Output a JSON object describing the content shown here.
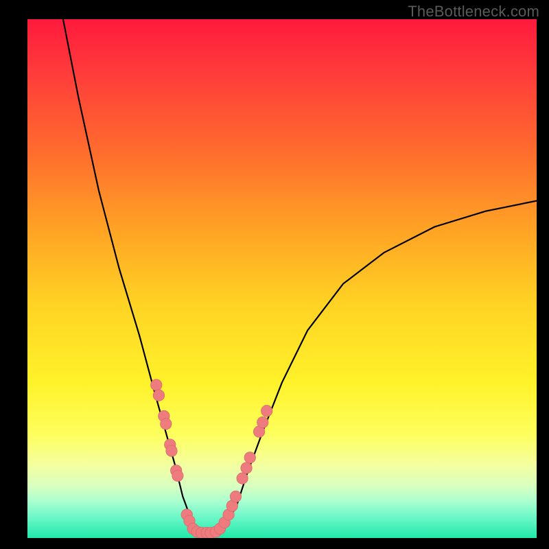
{
  "watermark": "TheBottleneck.com",
  "colors": {
    "curve": "#000000",
    "marker_fill": "#ee7b7d",
    "marker_stroke": "#d86a6c",
    "green_band": "#20e9a8"
  },
  "chart_data": {
    "type": "line",
    "title": "",
    "xlabel": "",
    "ylabel": "",
    "xlim": [
      0,
      100
    ],
    "ylim": [
      0,
      100
    ],
    "note": "No numeric tick labels, axis labels, or legend are present in the image; x/y values below are estimated from pixel positions on an implied 0–100 grid.",
    "series": [
      {
        "name": "bottleneck-curve",
        "x": [
          7,
          10,
          14,
          18,
          22,
          25,
          27,
          29,
          30.5,
          32,
          33,
          34,
          36,
          38.5,
          41,
          43,
          46,
          50,
          55,
          62,
          70,
          80,
          90,
          100
        ],
        "y": [
          100,
          85,
          67,
          52,
          39,
          28,
          21,
          14,
          8,
          4,
          1.5,
          1,
          1,
          2,
          6,
          12,
          20,
          30,
          40,
          49,
          55,
          60,
          63,
          65
        ]
      }
    ],
    "markers": {
      "name": "highlighted-points",
      "points": [
        {
          "x": 25.3,
          "y": 29.5
        },
        {
          "x": 25.8,
          "y": 27.5
        },
        {
          "x": 26.8,
          "y": 23.5
        },
        {
          "x": 27.2,
          "y": 22.0
        },
        {
          "x": 28.0,
          "y": 18.0
        },
        {
          "x": 28.3,
          "y": 16.8
        },
        {
          "x": 29.2,
          "y": 13.0
        },
        {
          "x": 29.5,
          "y": 12.0
        },
        {
          "x": 31.3,
          "y": 4.5
        },
        {
          "x": 31.8,
          "y": 3.3
        },
        {
          "x": 32.5,
          "y": 1.8
        },
        {
          "x": 33.3,
          "y": 1.2
        },
        {
          "x": 34.2,
          "y": 1.0
        },
        {
          "x": 35.2,
          "y": 1.0
        },
        {
          "x": 36.0,
          "y": 1.0
        },
        {
          "x": 37.0,
          "y": 1.2
        },
        {
          "x": 37.8,
          "y": 1.8
        },
        {
          "x": 38.7,
          "y": 3.0
        },
        {
          "x": 39.5,
          "y": 4.5
        },
        {
          "x": 40.2,
          "y": 6.2
        },
        {
          "x": 40.9,
          "y": 8.0
        },
        {
          "x": 42.2,
          "y": 11.5
        },
        {
          "x": 43.0,
          "y": 13.5
        },
        {
          "x": 43.7,
          "y": 15.5
        },
        {
          "x": 45.5,
          "y": 20.5
        },
        {
          "x": 46.2,
          "y": 22.3
        },
        {
          "x": 47.0,
          "y": 24.5
        }
      ]
    }
  }
}
